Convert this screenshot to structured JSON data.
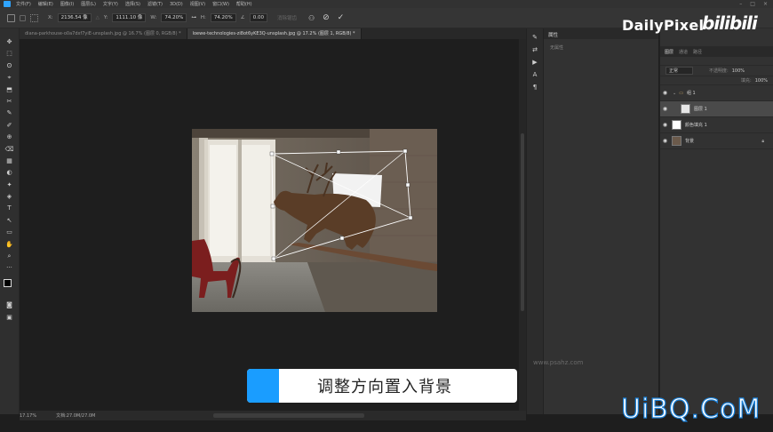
{
  "menu": {
    "items": [
      "文件(F)",
      "编辑(E)",
      "图像(I)",
      "图层(L)",
      "文字(Y)",
      "选择(S)",
      "滤镜(T)",
      "3D(D)",
      "视图(V)",
      "窗口(W)",
      "帮助(H)"
    ]
  },
  "window_controls": [
    "–",
    "□",
    "×"
  ],
  "options": {
    "x_label": "X:",
    "x_value": "2136.54 像",
    "y_label": "Y:",
    "y_value": "1111.10 像",
    "w_label": "W:",
    "w_value": "74.20%",
    "h_label": "H:",
    "h_value": "74.20%",
    "angle_label": "∠",
    "angle_value": "0.00",
    "interp_label": "消除锯齿",
    "cancel_glyph": "⊘",
    "commit_glyph": "✓"
  },
  "tabs": [
    {
      "label": "diana-parkhouse-o0a7dxf7yiE-unsplash.jpg @ 16.7% (图层 0, RGB/8) *",
      "active": false
    },
    {
      "label": "loewe-technologies-zi8ot6yKE3Q-unsplash.jpg @ 17.2% (图层 1, RGB/8) *",
      "active": true
    }
  ],
  "tools": [
    "✥",
    "⬚",
    "ʘ",
    "⌖",
    "⬒",
    "✂",
    "✎",
    "✐",
    "⊕",
    "⌫",
    "▦",
    "◐",
    "✦",
    "◈",
    "T",
    "↖",
    "▭",
    "✋",
    "⌕",
    "···"
  ],
  "status": {
    "zoom": "17.17%",
    "doc": "文档:27.0M/27.0M"
  },
  "properties": {
    "title": "属性",
    "empty": "无属性"
  },
  "layers_panel": {
    "tabs": [
      "图层",
      "通道",
      "路径"
    ],
    "blend_mode": "正常",
    "opacity_label": "不透明度:",
    "opacity_value": "100%",
    "fill_label": "填充:",
    "fill_value": "100%",
    "rows": [
      {
        "name": "组 1",
        "type": "group"
      },
      {
        "name": "图层 1",
        "type": "layer",
        "selected": true
      },
      {
        "name": "颜色填充 1",
        "type": "fill"
      },
      {
        "name": "背景",
        "type": "background"
      }
    ]
  },
  "brand": {
    "name": "DailyPixel",
    "site": "bilibili"
  },
  "watermark": "www.psahz.com",
  "caption": "调整方向置入背景",
  "corner_logo": "UiBQ.CoM",
  "colors": {
    "accent": "#1a9dff",
    "ui_bg": "#323232",
    "canvas_bg": "#1e1e1e"
  }
}
